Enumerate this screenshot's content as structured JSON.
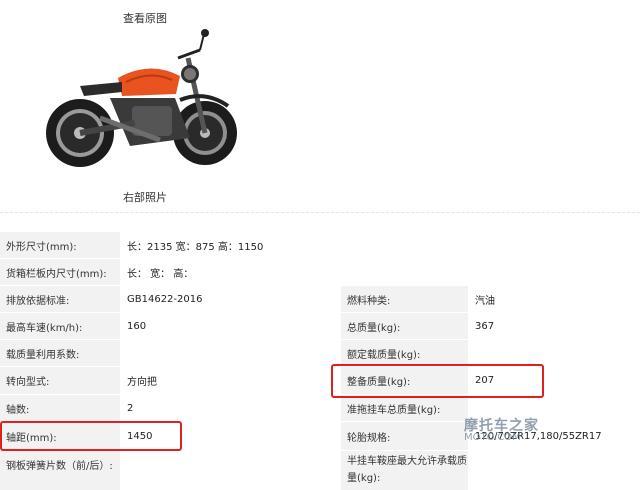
{
  "photo": {
    "top_caption": "查看原图",
    "bottom_caption": "右部照片"
  },
  "spec": {
    "rows": [
      {
        "l1": "外形尺寸(mm):",
        "v1": "长：2135 宽：875 高：1150"
      },
      {
        "l1": "货箱栏板内尺寸(mm):",
        "v1": "长：   宽：   高："
      },
      {
        "l1": "排放依据标准:",
        "v1": "GB14622-2016",
        "l2": "燃料种类:",
        "v2": "汽油"
      },
      {
        "l1": "最高车速(km/h):",
        "v1": "160",
        "l2": "总质量(kg):",
        "v2": "367"
      },
      {
        "l1": "载质量利用系数:",
        "v1": "",
        "l2": "额定载质量(kg):",
        "v2": ""
      },
      {
        "l1": "转向型式:",
        "v1": "方向把",
        "l2": "整备质量(kg):",
        "v2": "207"
      },
      {
        "l1": "轴数:",
        "v1": "2",
        "l2": "准拖挂车总质量(kg):",
        "v2": ""
      },
      {
        "l1": "轴距(mm):",
        "v1": "1450",
        "l2": "轮胎规格:",
        "v2": "120/70ZR17,180/55ZR17"
      },
      {
        "l1": "钢板弹簧片数（前/后）:",
        "v1": "",
        "l2": "半挂车鞍座最大允许承载质量(kg):",
        "v2": ""
      }
    ]
  },
  "colors": {
    "highlight": "#e02020",
    "label_bg": "#f2f2f2",
    "bike_accent": "#e8531f"
  },
  "watermark": {
    "line1": "摩托车之家",
    "line2": "MOTO.COM"
  }
}
